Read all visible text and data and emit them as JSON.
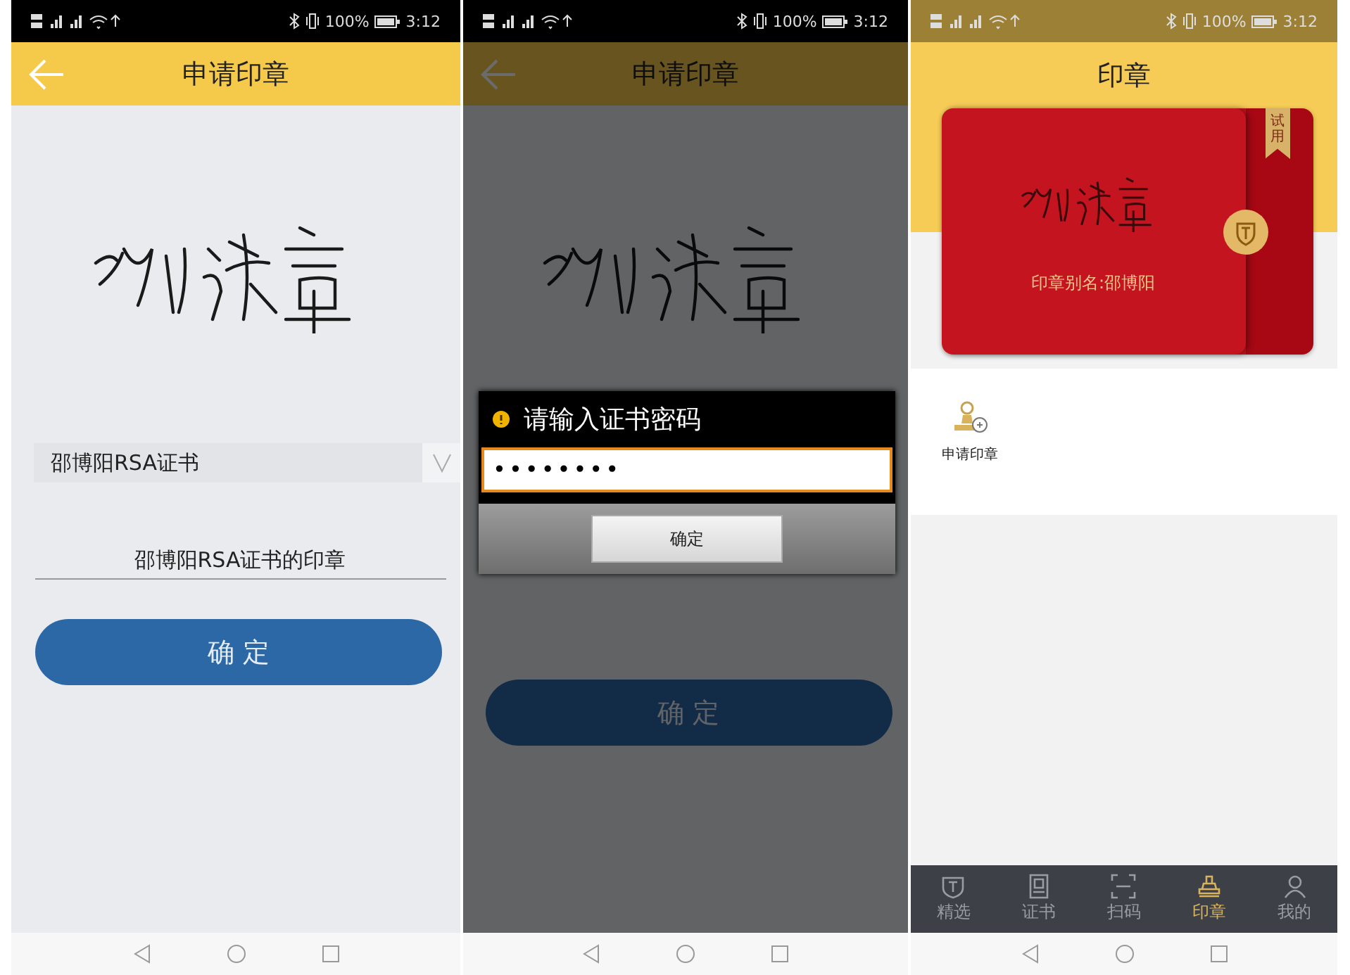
{
  "screens": [
    {
      "kind": "form",
      "status_bar": {
        "battery": "100%",
        "time": "3:12"
      },
      "header": {
        "title": "申请印章"
      },
      "certificate_select": {
        "value": "邵博阳RSA证书"
      },
      "seal_name_field": {
        "value": "邵博阳RSA证书的印章"
      },
      "confirm_button": "确 定"
    },
    {
      "kind": "dialog",
      "status_bar": {
        "battery": "100%",
        "time": "3:12"
      },
      "header": {
        "title": "申请印章"
      },
      "confirm_button": "确 定",
      "dialog": {
        "title": "请输入证书密码",
        "password": "••••••••",
        "button": "确定"
      }
    },
    {
      "kind": "home",
      "status_bar": {
        "battery": "100%",
        "time": "3:12"
      },
      "header": {
        "title": "印章"
      },
      "card": {
        "ribbon": "试用",
        "alias": "印章别名:邵博阳"
      },
      "actions": [
        {
          "label": "申请印章"
        }
      ],
      "tabs": [
        {
          "label": "精选",
          "selected": false
        },
        {
          "label": "证书",
          "selected": false
        },
        {
          "label": "扫码",
          "selected": false
        },
        {
          "label": "印章",
          "selected": true
        },
        {
          "label": "我的",
          "selected": false
        }
      ]
    }
  ]
}
